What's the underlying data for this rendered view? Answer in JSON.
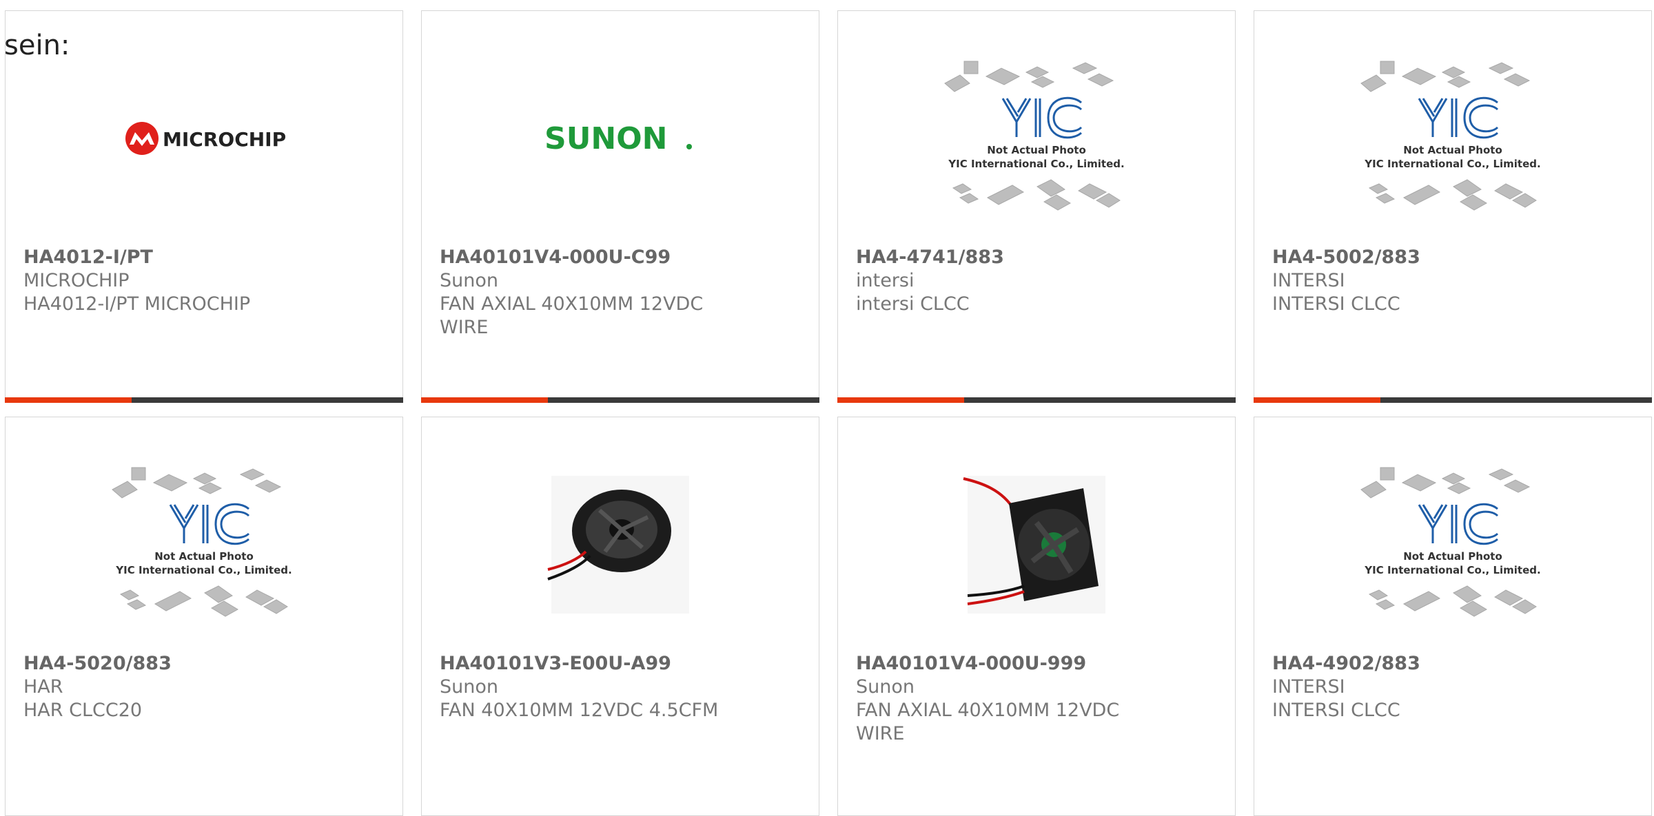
{
  "lead_text": "sein:",
  "colors": {
    "accent": "#e8380d",
    "bar": "#3a3a3a"
  },
  "placeholder": {
    "title": "Not Actual Photo",
    "subtitle": "YIC International Co., Limited."
  },
  "products": [
    {
      "part": "HA4012-I/PT",
      "manufacturer": "MICROCHIP",
      "desc1": "HA4012-I/PT MICROCHIP",
      "desc2": "",
      "image": "microchip-logo",
      "logo_text": "MICROCHIP"
    },
    {
      "part": "HA40101V4-000U-C99",
      "manufacturer": "Sunon",
      "desc1": "FAN AXIAL 40X10MM 12VDC",
      "desc2": "WIRE",
      "image": "sunon-logo",
      "logo_text": "SUNON"
    },
    {
      "part": "HA4-4741/883",
      "manufacturer": "intersi",
      "desc1": "intersi CLCC",
      "desc2": "",
      "image": "placeholder"
    },
    {
      "part": "HA4-5002/883",
      "manufacturer": "INTERSI",
      "desc1": "INTERSI CLCC",
      "desc2": "",
      "image": "placeholder"
    },
    {
      "part": "HA4-5020/883",
      "manufacturer": "HAR",
      "desc1": "HAR CLCC20",
      "desc2": "",
      "image": "placeholder"
    },
    {
      "part": "HA40101V3-E00U-A99",
      "manufacturer": "Sunon",
      "desc1": "FAN 40X10MM 12VDC 4.5CFM",
      "desc2": "",
      "image": "round-fan-photo"
    },
    {
      "part": "HA40101V4-000U-999",
      "manufacturer": "Sunon",
      "desc1": "FAN AXIAL 40X10MM 12VDC",
      "desc2": "WIRE",
      "image": "square-fan-photo"
    },
    {
      "part": "HA4-4902/883",
      "manufacturer": "INTERSI",
      "desc1": "INTERSI CLCC",
      "desc2": "",
      "image": "placeholder"
    }
  ]
}
